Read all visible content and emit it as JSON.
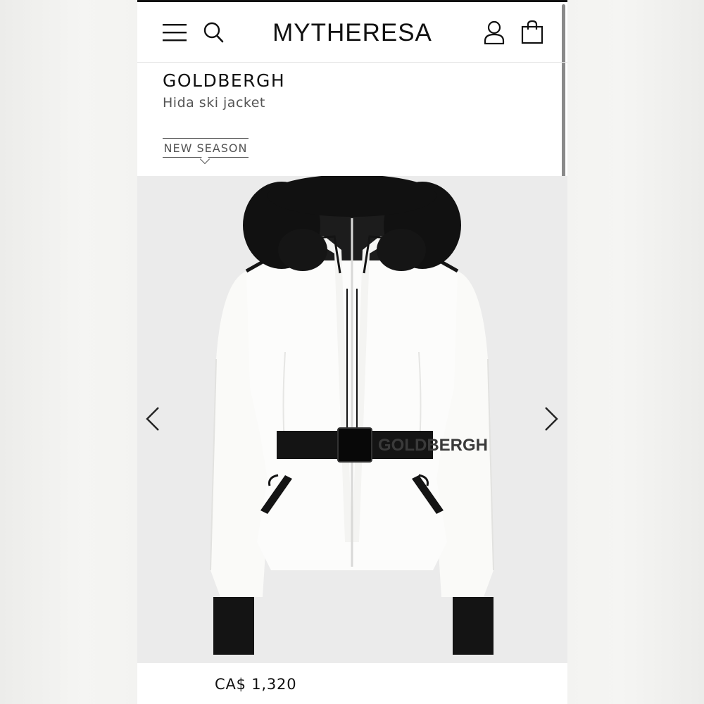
{
  "header": {
    "logo": "MYTHERESA",
    "icons": [
      "menu-icon",
      "search-icon",
      "account-icon",
      "shopping-bag-icon"
    ]
  },
  "product": {
    "brand": "GOLDBERGH",
    "name": "Hida ski jacket",
    "badge": "NEW SEASON",
    "price": "CA$ 1,320"
  },
  "gallery": {
    "image_icon": "white-ski-jacket-with-black-fur-hood-and-belt",
    "belt_text": "GOLDBERGH",
    "prev_icon": "chevron-left-icon",
    "next_icon": "chevron-right-icon"
  },
  "colors": {
    "text": "#111111",
    "secondary": "#555555",
    "gallery_bg": "#ebebeb",
    "sale": "#c0392b"
  }
}
